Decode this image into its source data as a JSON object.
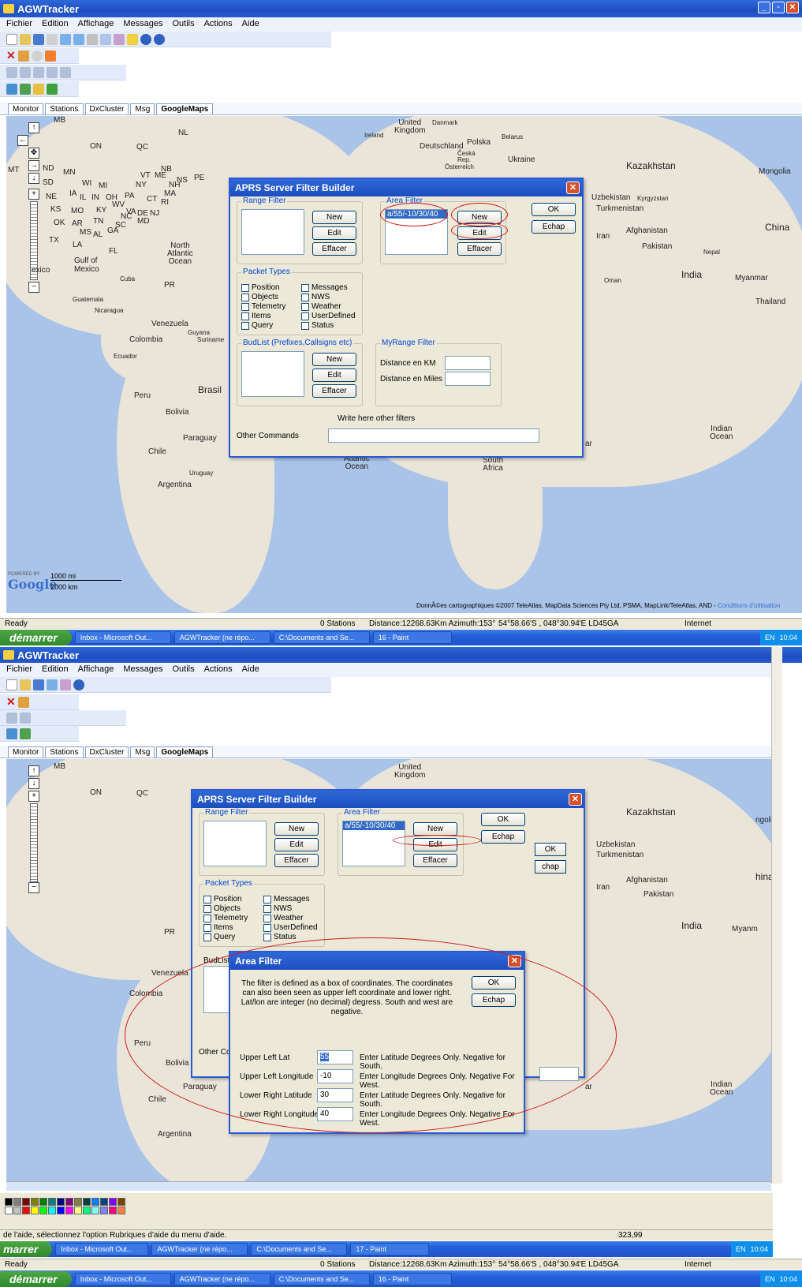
{
  "app": {
    "title": "AGWTracker"
  },
  "menu": [
    "Fichier",
    "Edition",
    "Affichage",
    "Messages",
    "Outils",
    "Actions",
    "Aide"
  ],
  "tabs": [
    "Monitor",
    "Stations",
    "DxCluster",
    "Msg",
    "GoogleMaps"
  ],
  "map_labels": {
    "canada_nl": "NL",
    "on": "ON",
    "qc": "QC",
    "mb": "MB",
    "mt": "MT",
    "nd": "ND",
    "mn": "MN",
    "sd": "SD",
    "wi": "WI",
    "mi": "MI",
    "ne": "NE",
    "ia": "IA",
    "ks": "KS",
    "mo": "MO",
    "ok": "OK",
    "ar": "AR",
    "tx": "TX",
    "tn": "TN",
    "ms": "MS",
    "al": "AL",
    "ga": "GA",
    "sc": "SC",
    "nc": "NC",
    "ky": "KY",
    "wv": "WV",
    "va": "VA",
    "oh": "OH",
    "in": "IN",
    "il": "IL",
    "pa": "PA",
    "ny": "NY",
    "vt": "VT",
    "me": "ME",
    "nh": "NH",
    "ma": "MA",
    "ri": "RI",
    "ct": "CT",
    "nj": "NJ",
    "de": "DE",
    "md": "MD",
    "nb": "NB",
    "ns": "NS",
    "pe": "PE",
    "la": "LA",
    "fl": "FL",
    "gulf": "Gulf of\nMexico",
    "mexico": "exico",
    "cuba": "Cuba",
    "pr": "PR",
    "guatemala": "Guatemala",
    "nicaragua": "Nicaragua",
    "venezuela": "Venezuela",
    "guyana": "Guyana",
    "suriname": "Suriname",
    "colombia": "Colombia",
    "ecuador": "Ecuador",
    "peru": "Peru",
    "bolivia": "Bolivia",
    "brasil": "Brasil",
    "paraguay": "Paraguay",
    "chile": "Chile",
    "uruguay": "Uruguay",
    "argentina": "Argentina",
    "north_atlantic": "North\nAtlantic\nOcean",
    "south_atlantic": "South\nAtlantic\nOcean",
    "indian_ocean": "Indian\nOcean",
    "uk": "United\nKingdom",
    "ireland": "Ireland",
    "danmark": "Danmark",
    "deutschland": "Deutschland",
    "polska": "Polska",
    "belarus": "Belarus",
    "ceska": "Česká\nRep.",
    "osterreich": "Österreich",
    "ukraine": "Ukraine",
    "kazakhstan": "Kazakhstan",
    "mongolia": "Mongolia",
    "mongolia_cut": "ngolia",
    "uzbekistan": "Uzbekistan",
    "kyrgyzstan": "Kyrgyzstan",
    "turkmenistan": "Turkmenistan",
    "china": "China",
    "china_cut": "hina",
    "afghanistan": "Afghanistan",
    "pakistan": "Pakistan",
    "iran": "Iran",
    "nepal": "Nepal",
    "india": "India",
    "myanmar": "Myanmar",
    "myanmar_cut": "Myanm",
    "thailand": "Thailand",
    "oman": "Oman",
    "south_africa": "South\nAfrica",
    "ar_cut": "ar",
    "scale_mi": "1000 mi",
    "scale_km": "2000 km",
    "powered": "POWERED BY",
    "google": "Google",
    "copyright": "DonnÃ©es cartographiques ©2007 TeleAtlas, MapData Sciences Pty Ltd, PSMA, MapLink/TeleAtlas, AND -",
    "conditions": "Conditions d'utilisation"
  },
  "status1": {
    "ready": "Ready",
    "stations": "0 Stations",
    "distance": "Distance:12268.63Km Azimuth:153°",
    "coords": "54°58.66'S , 048°30.94'E LD45GA",
    "internet": "Internet"
  },
  "taskbar1": {
    "start": "démarrer",
    "items": [
      "Inbox - Microsoft Out...",
      "AGWTracker (ne répo...",
      "C:\\Documents and Se...",
      "16 - Paint"
    ],
    "lang": "EN",
    "time": "10:04"
  },
  "filter_builder": {
    "title": "APRS Server Filter Builder",
    "range_filter": "Range Filter",
    "area_filter": "Area Filter",
    "area_item": "a/55/-10/30/40",
    "new": "New",
    "edit": "Edit",
    "effacer": "Effacer",
    "ok": "OK",
    "echap": "Echap",
    "packet_types": "Packet Types",
    "types_left": [
      "Position",
      "Objects",
      "Telemetry",
      "Items",
      "Query"
    ],
    "types_right": [
      "Messages",
      "NWS",
      "Weather",
      "UserDefined",
      "Status"
    ],
    "budlist": "BudList (Prefixes,Callsigns etc)",
    "budlist_cut": "BudList",
    "myrange": "MyRange Filter",
    "dist_km": "Distance en KM",
    "dist_miles": "Distance en Miles",
    "write_here": "Write here other filters",
    "other_commands": "Other Commands",
    "other_cut": "Other Cor",
    "chap": "chap"
  },
  "area_filter": {
    "title": "Area Filter",
    "desc": "The filter is defined as a box of coordinates. The coordinates can also been seen as upper left coordinate and lower right. Lat/lon are integer (no decimal) degress. South and west are negative.",
    "ok": "OK",
    "echap": "Echap",
    "rows": [
      {
        "label": "Upper Left Lat",
        "value": "55",
        "hint": "Enter Latitude Degrees Only. Negative for South."
      },
      {
        "label": "Upper Left Longitude",
        "value": "-10",
        "hint": "Enter Longitude Degrees Only. Negative For West."
      },
      {
        "label": "Lower Right Latitude",
        "value": "30",
        "hint": "Enter Latitude Degrees Only. Negative for South."
      },
      {
        "label": "Lower Right Longitude",
        "value": "40",
        "hint": "Enter Longitude Degrees Only. Negative For West."
      }
    ]
  },
  "paint_status": {
    "help": "de l'aide, sélectionnez l'option Rubriques d'aide du menu d'aide.",
    "pos": "323,99"
  },
  "taskbar2": {
    "start": "marrer",
    "items": [
      "Inbox - Microsoft Out...",
      "AGWTracker (ne répo...",
      "C:\\Documents and Se...",
      "17 - Paint"
    ],
    "lang": "EN",
    "time": "10:04"
  },
  "palette": [
    "#000000",
    "#808080",
    "#800000",
    "#808000",
    "#008000",
    "#008080",
    "#000080",
    "#800080",
    "#808040",
    "#004040",
    "#0080ff",
    "#004080",
    "#8000ff",
    "#804000",
    "#ffffff",
    "#c0c0c0",
    "#ff0000",
    "#ffff00",
    "#00ff00",
    "#00ffff",
    "#0000ff",
    "#ff00ff",
    "#ffff80",
    "#00ff80",
    "#80ffff",
    "#8080ff",
    "#ff0080",
    "#ff8040"
  ]
}
